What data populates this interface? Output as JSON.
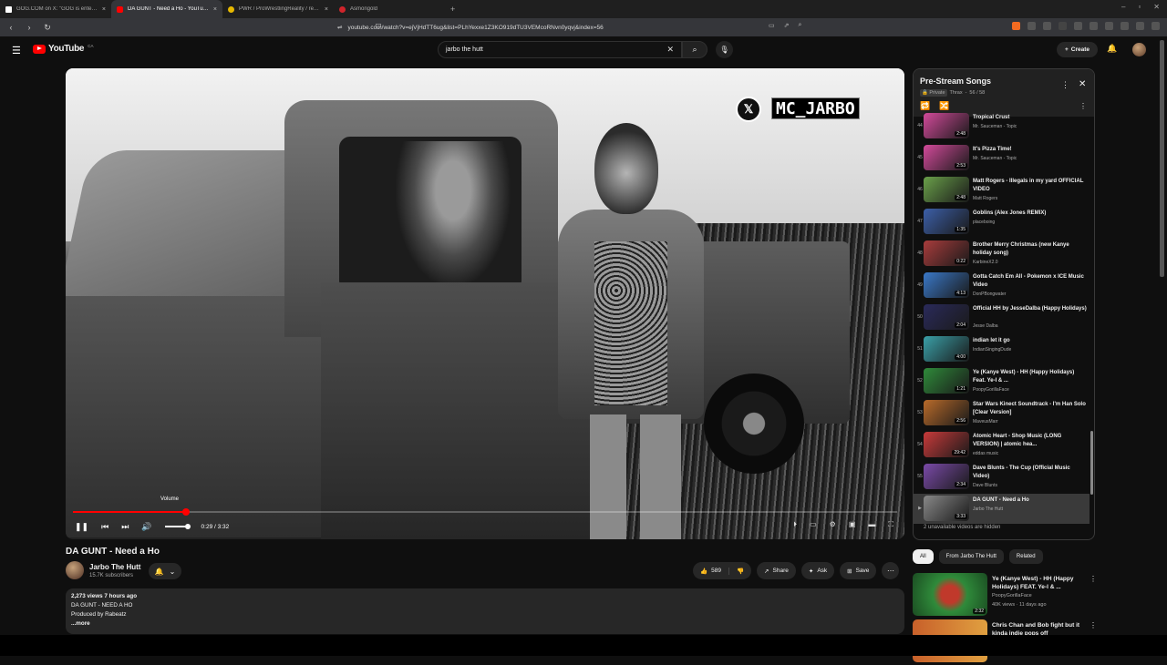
{
  "browser": {
    "tabs": [
      {
        "label": "GOG.COM on X: \"GOG is entering a",
        "color": "#ffffff"
      },
      {
        "label": "DA GUNT - Need a Ho - YouTube",
        "color": "#ff0000"
      },
      {
        "label": "PWR / ProWrestlingReality / realpeti",
        "color": "#e6b800"
      },
      {
        "label": "Asmongold",
        "color": "#d0242b"
      }
    ],
    "url": "youtube.com/watch?v=ejVjHdTT6ug&list=PLhYexxe1Z3KO919dTU3VEMcoRNvn0yqvj&index=56"
  },
  "youtube": {
    "logo": "YouTube",
    "region": "CA",
    "search_query": "jarbo the hutt",
    "create_label": "Create"
  },
  "player": {
    "overlay_handle": "MC_JARBO",
    "tooltip": "Volume",
    "time": "0:29 / 3:32",
    "progress": 0.137,
    "volume": 1.0
  },
  "video": {
    "title": "DA GUNT - Need a Ho",
    "channel": "Jarbo The Hutt",
    "subscribers": "15.7K subscribers",
    "likes": "589",
    "share": "Share",
    "ask": "Ask",
    "save": "Save",
    "desc_meta": "2,273 views  7 hours ago",
    "desc_line1": "DA GUNT - NEED A HO",
    "desc_line2": "Produced by Rabeatz",
    "desc_more": "...more"
  },
  "playlist": {
    "title": "Pre-Stream Songs",
    "privacy": "Private",
    "owner": "Thrax",
    "position": "56 / 58",
    "footer": "2 unavailable videos are hidden",
    "items": [
      {
        "num": "44",
        "title": "Tropical Crust",
        "author": "Mr. Sauceman - Topic",
        "dur": "2:48",
        "thumb": "#d24a9a"
      },
      {
        "num": "45",
        "title": "It's Pizza Time!",
        "author": "Mr. Sauceman - Topic",
        "dur": "2:53",
        "thumb": "#d24a9a"
      },
      {
        "num": "46",
        "title": "Matt Rogers - Illegals in my yard OFFICIAL VIDEO",
        "author": "Matt Rogers",
        "dur": "2:48",
        "thumb": "#6aa04a"
      },
      {
        "num": "47",
        "title": "Goblins (Alex Jones REMIX)",
        "author": "placeboing",
        "dur": "1:35",
        "thumb": "#3c5fa8"
      },
      {
        "num": "48",
        "title": "Brother Merry Christmas (new Kanye holiday song)",
        "author": "KarbineX2.0",
        "dur": "0:22",
        "thumb": "#a83c3c"
      },
      {
        "num": "49",
        "title": "Gotta Catch Em All - Pokemon x ICE Music Video",
        "author": "DonPBongwater",
        "dur": "4:13",
        "thumb": "#3a78c8"
      },
      {
        "num": "50",
        "title": "Official HH by JesseDalba (Happy Holidays)",
        "author": "Jesse Dalba",
        "dur": "2:04",
        "thumb": "#2a2a5a"
      },
      {
        "num": "51",
        "title": "indian let it go",
        "author": "IndianSingingDude",
        "dur": "4:00",
        "thumb": "#3aa0a8"
      },
      {
        "num": "52",
        "title": "Ye (Kanye West) - HH (Happy Holidays) Feat. Ye-I & ...",
        "author": "PoopyGorillaFace",
        "dur": "1:21",
        "thumb": "#2f8a3a"
      },
      {
        "num": "53",
        "title": "Star Wars Kinect Soundtrack - I'm Han Solo [Clear Version]",
        "author": "MaveusMarr",
        "dur": "2:56",
        "thumb": "#b86a2a"
      },
      {
        "num": "54",
        "title": "Atomic Heart - Shop Music (LONG VERSION) | atomic hea...",
        "author": "eddas music",
        "dur": "29:42",
        "thumb": "#c83a3a"
      },
      {
        "num": "55",
        "title": "Dave Blunts - The Cup (Official Music Video)",
        "author": "Dave Blunts",
        "dur": "2:34",
        "thumb": "#7a4aa8"
      },
      {
        "num": "▶",
        "title": "DA GUNT - Need a Ho",
        "author": "Jarbo The Hutt",
        "dur": "3:33",
        "thumb": "#888888"
      }
    ]
  },
  "chips": [
    "All",
    "From Jarbo The Hutt",
    "Related"
  ],
  "recs": [
    {
      "title": "Ye (Kanye West) - HH (Happy Holidays) FEAT. Ye-I & ...",
      "author": "PoopyGorillaFace",
      "meta": "40K views · 11 days ago",
      "dur": "2:32",
      "thumb": "#2f8a3a"
    },
    {
      "title": "Chris Chan and Bob fight but it kinda indie pops off",
      "author": "",
      "meta": "",
      "dur": "",
      "thumb": "#c8602a"
    }
  ]
}
